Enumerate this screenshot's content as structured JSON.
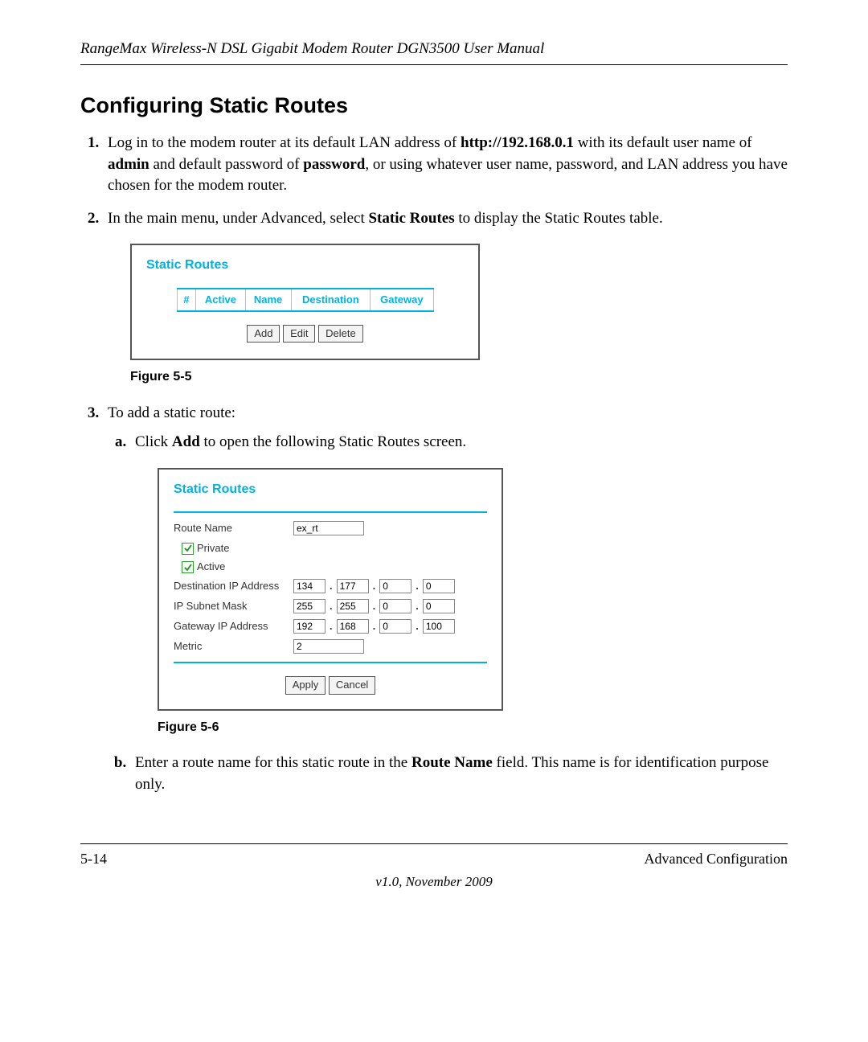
{
  "header": {
    "title": "RangeMax Wireless-N DSL Gigabit Modem Router DGN3500 User Manual"
  },
  "section_title": "Configuring Static Routes",
  "steps": {
    "step1": {
      "pre": "Log in to the modem router at its default LAN address of ",
      "url": "http://192.168.0.1",
      "mid1": " with its default user name of ",
      "admin": "admin",
      "mid2": " and default password of ",
      "password": "password",
      "post": ", or using whatever user name, password, and LAN address you have chosen for the modem router."
    },
    "step2": {
      "pre": "In the main menu, under Advanced, select ",
      "bold": "Static Routes",
      "post": " to display the Static Routes table."
    },
    "step3": {
      "text": "To add a static route:",
      "a": {
        "pre": "Click ",
        "bold": "Add",
        "post": " to open the following Static Routes screen."
      },
      "b": {
        "pre": "Enter a route name for this static route in the ",
        "bold": "Route Name",
        "post": " field. This name is for identification purpose only."
      }
    }
  },
  "figure1": {
    "title": "Static Routes",
    "columns": {
      "num": "#",
      "active": "Active",
      "name": "Name",
      "dest": "Destination",
      "gateway": "Gateway"
    },
    "buttons": {
      "add": "Add",
      "edit": "Edit",
      "delete": "Delete"
    },
    "caption": "Figure 5-5"
  },
  "figure2": {
    "title": "Static Routes",
    "labels": {
      "route_name": "Route Name",
      "private": "Private",
      "active": "Active",
      "dest_ip": "Destination IP Address",
      "subnet": "IP Subnet Mask",
      "gateway": "Gateway IP Address",
      "metric": "Metric"
    },
    "values": {
      "route_name": "ex_rt",
      "dest": [
        "134",
        "177",
        "0",
        "0"
      ],
      "subnet": [
        "255",
        "255",
        "0",
        "0"
      ],
      "gateway": [
        "192",
        "168",
        "0",
        "100"
      ],
      "metric": "2"
    },
    "buttons": {
      "apply": "Apply",
      "cancel": "Cancel"
    },
    "caption": "Figure 5-6"
  },
  "footer": {
    "page": "5-14",
    "section": "Advanced Configuration",
    "version": "v1.0, November 2009"
  }
}
